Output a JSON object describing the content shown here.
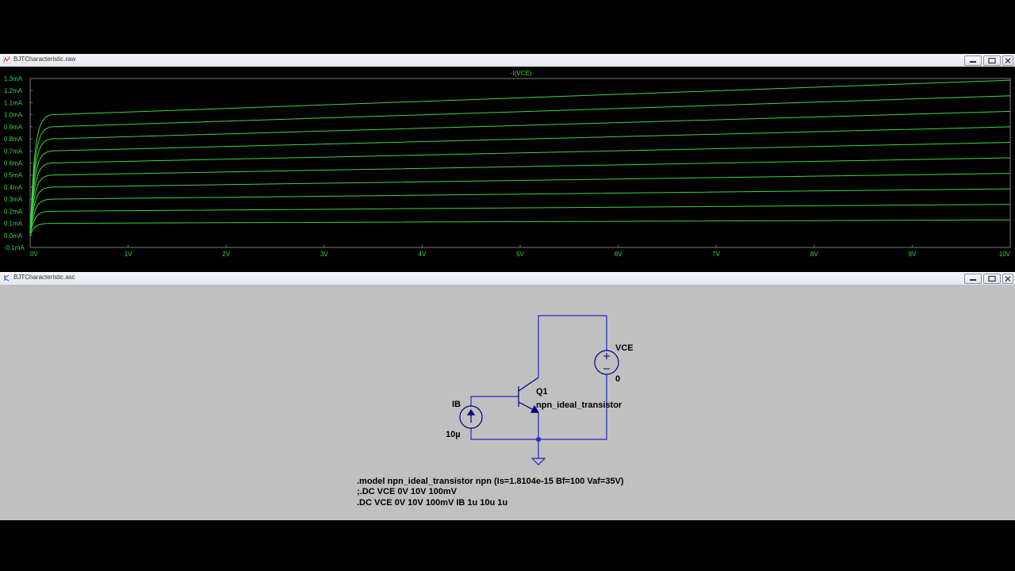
{
  "plot_window": {
    "title": "BJTCharacteristic.raw",
    "trace_label": "-I(VCE)",
    "colors": {
      "background": "#000000",
      "trace": "#3cd63c",
      "grid": "#3c3c3c",
      "axis_text": "#3cd63c"
    }
  },
  "chart_data": {
    "type": "line",
    "title": "-I(VCE)",
    "xlabel": "",
    "ylabel": "",
    "x_ticks": [
      "0V",
      "1V",
      "2V",
      "3V",
      "4V",
      "5V",
      "6V",
      "7V",
      "8V",
      "9V",
      "10V"
    ],
    "y_ticks": [
      "1.3mA",
      "1.2mA",
      "1.1mA",
      "1.0mA",
      "0.9mA",
      "0.8mA",
      "0.7mA",
      "0.6mA",
      "0.5mA",
      "0.4mA",
      "0.3mA",
      "0.2mA",
      "0.1mA",
      "0.0mA",
      "-0.1mA"
    ],
    "xlim": [
      0,
      10
    ],
    "ylim": [
      -0.1,
      1.3
    ],
    "series": [
      {
        "ib": 1,
        "knee": [
          0.22,
          0.1
        ],
        "end": [
          10,
          0.128
        ]
      },
      {
        "ib": 2,
        "knee": [
          0.22,
          0.2
        ],
        "end": [
          10,
          0.257
        ]
      },
      {
        "ib": 3,
        "knee": [
          0.22,
          0.3
        ],
        "end": [
          10,
          0.386
        ]
      },
      {
        "ib": 4,
        "knee": [
          0.22,
          0.4
        ],
        "end": [
          10,
          0.514
        ]
      },
      {
        "ib": 5,
        "knee": [
          0.22,
          0.5
        ],
        "end": [
          10,
          0.643
        ]
      },
      {
        "ib": 6,
        "knee": [
          0.22,
          0.6
        ],
        "end": [
          10,
          0.771
        ]
      },
      {
        "ib": 7,
        "knee": [
          0.22,
          0.7
        ],
        "end": [
          10,
          0.9
        ]
      },
      {
        "ib": 8,
        "knee": [
          0.22,
          0.8
        ],
        "end": [
          10,
          1.028
        ]
      },
      {
        "ib": 9,
        "knee": [
          0.22,
          0.9
        ],
        "end": [
          10,
          1.157
        ]
      },
      {
        "ib": 10,
        "knee": [
          0.22,
          1.0
        ],
        "end": [
          10,
          1.286
        ]
      }
    ]
  },
  "schematic_window": {
    "title": "BJTCharacteristic.asc",
    "colors": {
      "background": "#c0c0c0",
      "wire": "#2323c8",
      "component": "#000080",
      "text": "#000000",
      "junction": "#2323c8"
    },
    "components": {
      "transistor": {
        "name": "Q1",
        "model": "npn_ideal_transistor"
      },
      "voltage_source": {
        "name": "VCE",
        "value": "0"
      },
      "current_source": {
        "name": "IB",
        "value": "10µ"
      }
    },
    "directives": [
      ".model npn_ideal_transistor npn (Is=1.8104e-15 Bf=100 Vaf=35V)",
      ";.DC VCE 0V 10V 100mV",
      ".DC VCE 0V 10V 100mV IB 1u 10u 1u"
    ]
  }
}
